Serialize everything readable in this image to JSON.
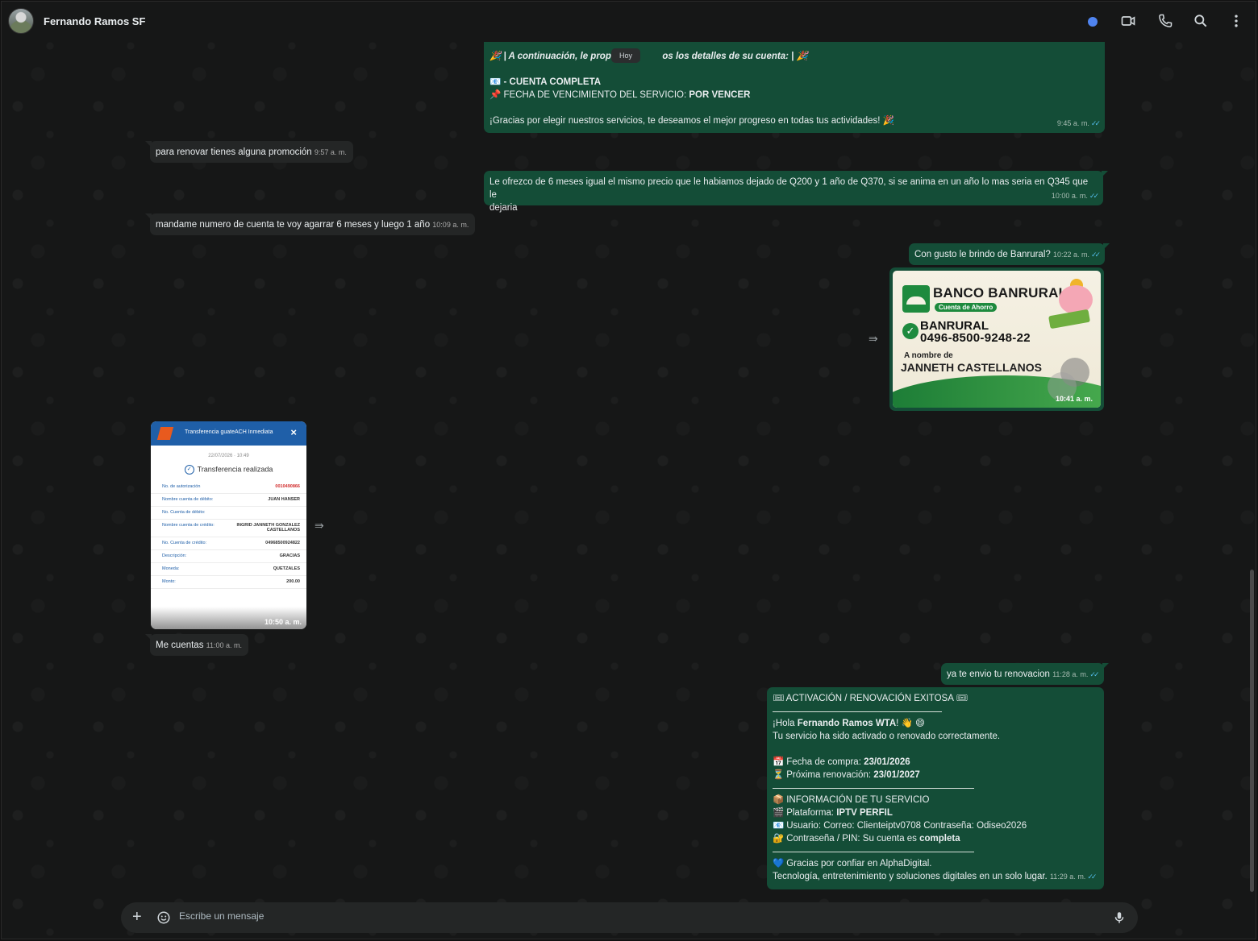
{
  "header": {
    "contact_name": "Fernando Ramos SF"
  },
  "date_chip": "Hoy",
  "messages": {
    "m1": {
      "line1": "🎉 | A continuación, le propor",
      "line1b": "os los detalles de su cuenta: | 🎉",
      "line2_icon": "📧",
      "line2": "- CUENTA COMPLETA",
      "line3_icon": "📌",
      "line3_label": "FECHA DE VENCIMIENTO DEL SERVICIO: ",
      "line3_value": "POR VENCER",
      "line4": "¡Gracias por elegir nuestros servicios, te deseamos el mejor progreso en todas tus actividades! 🎉",
      "time": "9:45 a. m."
    },
    "m2": {
      "text": "para renovar tienes alguna promoción",
      "time": "9:57 a. m."
    },
    "m3": {
      "text1": "Le ofrezco de 6 meses igual el mismo precio que le habiamos dejado de Q200 y 1 año de Q370, si se anima en un año lo mas seria en Q345 que le",
      "text2": "dejaria",
      "time": "10:00 a. m."
    },
    "m4": {
      "text": "mandame numero de cuenta  te voy agarrar 6 meses y luego 1 año",
      "time": "10:09 a. m."
    },
    "m5": {
      "text": "Con gusto le brindo de Banrural?",
      "time": "10:22 a. m."
    },
    "m6": {
      "bank_title": "BANCO BANRURAL",
      "bank_sub": "Cuenta de Ahorro",
      "bank_name": "BANRURAL",
      "bank_account": "0496-8500-9248-22",
      "holder_label": "A nombre de",
      "holder_name": "JANNETH CASTELLANOS",
      "time": "10:41 a. m."
    },
    "m7": {
      "title": "Transferencia guateACH Inmediata",
      "date": "22/07/2026 · 10:49",
      "status": "Transferencia realizada",
      "rows": [
        {
          "k": "No. de autorización",
          "v": "0010490866"
        },
        {
          "k": "Nombre cuenta de débito:",
          "v": "JUAN HANSER"
        },
        {
          "k": "No. Cuenta de débito:",
          "v": ""
        },
        {
          "k": "Nombre cuenta de crédito:",
          "v": "INGRID JANNETH GONZALEZ CASTELLANOS"
        },
        {
          "k": "No. Cuenta de crédito:",
          "v": "04968500924822"
        },
        {
          "k": "Descripción:",
          "v": "GRACIAS"
        },
        {
          "k": "Moneda:",
          "v": "QUETZALES"
        },
        {
          "k": "Monto:",
          "v": "200.00"
        }
      ],
      "time": "10:50 a. m."
    },
    "m8": {
      "text": "Me cuentas",
      "time": "11:00 a. m."
    },
    "m9": {
      "text": "ya te envio tu renovacion",
      "time": "11:28 a. m."
    },
    "m10": {
      "title": "ACTIVACIÓN / RENOVACIÓN EXITOSA",
      "greet_pre": "¡Hola ",
      "greet_name": "Fernando Ramos WTA",
      "greet_post": "! 👋 😄",
      "activated": "Tu servicio ha sido activado o renovado correctamente.",
      "purchase_label": "Fecha de compra: ",
      "purchase_date": "23/01/2026",
      "renew_label": "Próxima renovación: ",
      "renew_date": "23/01/2027",
      "info_title": "INFORMACIÓN DE TU SERVICIO",
      "platform_label": "Plataforma: ",
      "platform_value": "IPTV PERFIL",
      "user_line": "Usuario: Correo: Clienteiptv0708 Contraseña: Odiseo2026",
      "pin_label": "Contraseña / PIN: Su cuenta es ",
      "pin_value": "completa",
      "thanks": "Gracias por confiar en AlphaDigital.",
      "tagline": "Tecnología, entretenimiento y soluciones digitales en un solo lugar.",
      "time": "11:29 a. m."
    }
  },
  "composer": {
    "placeholder": "Escribe un mensaje"
  },
  "colors": {
    "outgoing": "#144d37",
    "incoming": "#242626",
    "ticks": "#53bdeb"
  }
}
